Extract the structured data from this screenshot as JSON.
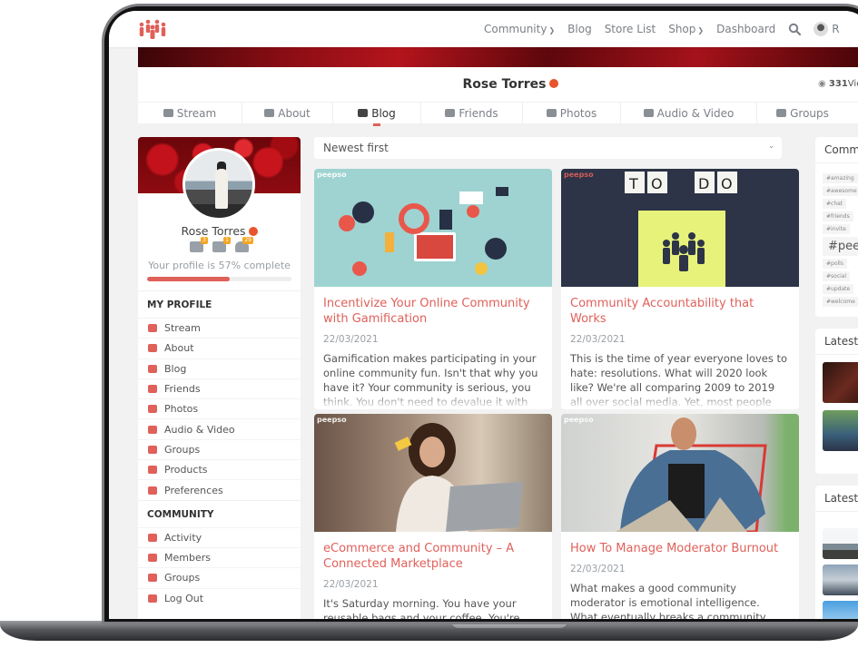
{
  "nav": {
    "items": [
      {
        "label": "Community",
        "dropdown": true
      },
      {
        "label": "Blog",
        "dropdown": false
      },
      {
        "label": "Store List",
        "dropdown": false
      },
      {
        "label": "Shop",
        "dropdown": true
      },
      {
        "label": "Dashboard",
        "dropdown": false
      }
    ],
    "user_initial": "R"
  },
  "profile": {
    "name": "Rose Torres",
    "views_count": "331",
    "views_label": "Views",
    "tabs": [
      {
        "label": "Stream",
        "icon": "home-icon"
      },
      {
        "label": "About",
        "icon": "user-icon"
      },
      {
        "label": "Blog",
        "icon": "blog-icon",
        "active": true
      },
      {
        "label": "Friends",
        "icon": "friends-icon"
      },
      {
        "label": "Photos",
        "icon": "camera-icon"
      },
      {
        "label": "Audio & Video",
        "icon": "video-icon"
      },
      {
        "label": "Groups",
        "icon": "groups-icon"
      }
    ]
  },
  "sidebar": {
    "name": "Rose Torres",
    "notifications": {
      "friends": "3",
      "messages": "1",
      "alerts": "29"
    },
    "completion_text": "Your profile is 57% complete",
    "completion_percent": 57,
    "my_profile_title": "MY PROFILE",
    "my_profile": [
      {
        "label": "Stream",
        "icon": "home-icon"
      },
      {
        "label": "About",
        "icon": "user-icon"
      },
      {
        "label": "Blog",
        "icon": "blog-icon"
      },
      {
        "label": "Friends",
        "icon": "friends-icon"
      },
      {
        "label": "Photos",
        "icon": "camera-icon"
      },
      {
        "label": "Audio & Video",
        "icon": "video-icon"
      },
      {
        "label": "Groups",
        "icon": "groups-icon"
      },
      {
        "label": "Products",
        "icon": "cart-icon"
      },
      {
        "label": "Preferences",
        "icon": "gear-icon"
      }
    ],
    "community_title": "COMMUNITY",
    "community": [
      {
        "label": "Activity",
        "icon": "home-icon"
      },
      {
        "label": "Members",
        "icon": "members-icon"
      },
      {
        "label": "Groups",
        "icon": "groups-icon"
      },
      {
        "label": "Log Out",
        "icon": "power-icon"
      }
    ]
  },
  "blog": {
    "sort_selected": "Newest first",
    "watermark": "peepso",
    "posts": [
      {
        "title": "Incentivize Your Online Community with Gamification",
        "date": "22/03/2021",
        "excerpt": "Gamification makes participating in your online community fun. Isn't that why you have it? Your community is serious, you think. You don't need to devalue it with"
      },
      {
        "title": "Community Accountability that Works",
        "date": "22/03/2021",
        "excerpt": "This is the time of year everyone loves to hate: resolutions. What will 2020 look like? We're all comparing 2009 to 2019 all over social media. Yet, most people understand that resolutions — if they are not"
      },
      {
        "title": "eCommerce and Community – A Connected Marketplace",
        "date": "22/03/2021",
        "excerpt": "It's Saturday morning. You have your reusable bags and your coffee. You're"
      },
      {
        "title": "How To Manage Moderator Burnout",
        "date": "22/03/2021",
        "excerpt": "What makes a good community moderator is emotional intelligence. What eventually breaks a community moderator is"
      }
    ]
  },
  "right": {
    "hashtags_title": "Community Hashtags",
    "hashtags": [
      "#amazing",
      "#awesome",
      "#chat",
      "#friends",
      "#invite",
      "#peepso",
      "#polls",
      "#social",
      "#update",
      "#welcome"
    ],
    "latest_videos_title": "Latest Videos",
    "latest_photos_title": "Latest Photos"
  }
}
